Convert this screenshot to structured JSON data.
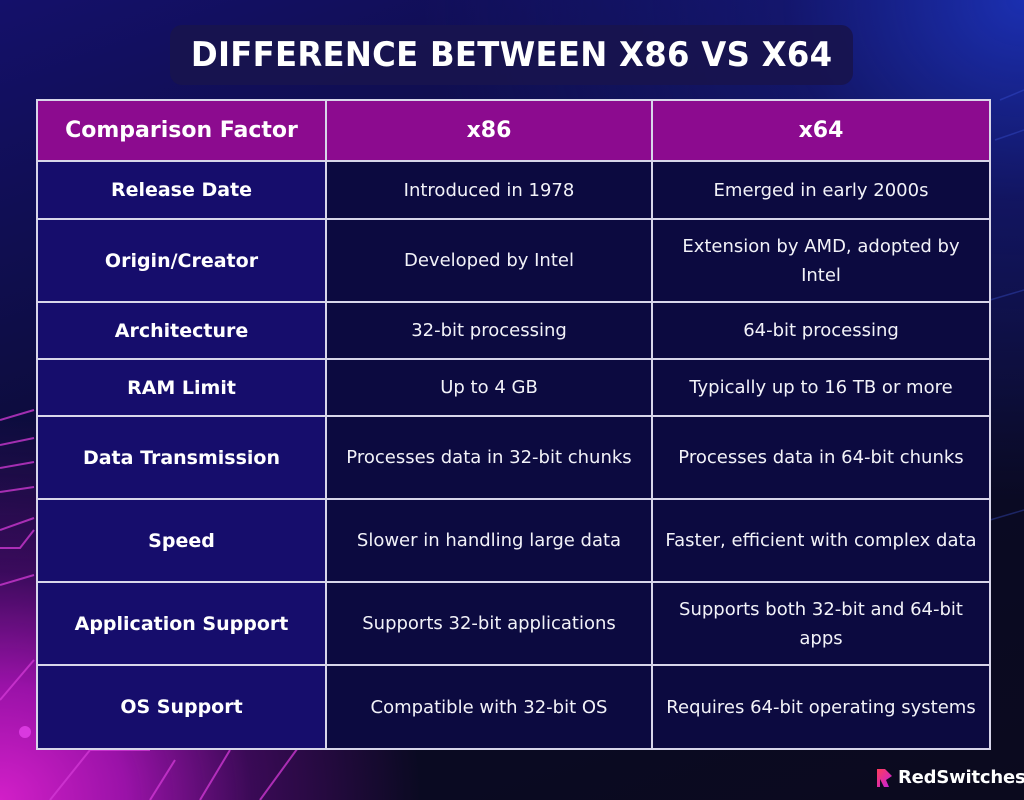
{
  "title": "DIFFERENCE BETWEEN X86 VS X64",
  "table": {
    "headers": [
      "Comparison Factor",
      "x86",
      "x64"
    ],
    "rows": [
      {
        "factor": "Release Date",
        "x86": "Introduced in 1978",
        "x64": "Emerged in early 2000s"
      },
      {
        "factor": "Origin/Creator",
        "x86": "Developed by Intel",
        "x64": "Extension by AMD, adopted by Intel"
      },
      {
        "factor": "Architecture",
        "x86": "32-bit processing",
        "x64": "64-bit processing"
      },
      {
        "factor": "RAM Limit",
        "x86": "Up to 4 GB",
        "x64": "Typically up to 16 TB or more"
      },
      {
        "factor": "Data Transmission",
        "x86": "Processes data in 32-bit chunks",
        "x64": "Processes data in 64-bit chunks"
      },
      {
        "factor": "Speed",
        "x86": "Slower in handling large data",
        "x64": "Faster, efficient with complex data"
      },
      {
        "factor": "Application Support",
        "x86": "Supports 32-bit applications",
        "x64": "Supports both 32-bit and 64-bit apps"
      },
      {
        "factor": "OS Support",
        "x86": "Compatible with 32-bit OS",
        "x64": "Requires 64-bit operating systems"
      }
    ]
  },
  "brand": {
    "name": "RedSwitches",
    "icon": "redswitches-logo-icon"
  },
  "colors": {
    "header_bg": "#8c0b8f",
    "factor_bg": "#160d6c",
    "value_bg": "#0c0a40",
    "title_bg": "#18144e",
    "brand_gradient_start": "#ff3d5a",
    "brand_gradient_end": "#c21ee0"
  }
}
